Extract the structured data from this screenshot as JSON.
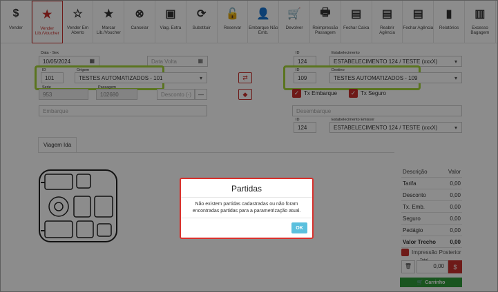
{
  "toolbar": [
    {
      "label": "Vender",
      "icon": "dollar-icon",
      "glyph": "$"
    },
    {
      "label": "Vender Lib./Voucher",
      "icon": "star-dollar-icon",
      "glyph": "★",
      "active": true
    },
    {
      "label": "Vender Em Aberto",
      "icon": "star-outline-icon",
      "glyph": "☆"
    },
    {
      "label": "Marcar Lib./Voucher",
      "icon": "star-filled-icon",
      "glyph": "★"
    },
    {
      "label": "Cancelar",
      "icon": "cancel-icon",
      "glyph": "⊗"
    },
    {
      "label": "Viag. Extra",
      "icon": "bus-icon",
      "glyph": "▣"
    },
    {
      "label": "Substituir",
      "icon": "refresh-icon",
      "glyph": "⟳"
    },
    {
      "label": "Reservar",
      "icon": "lock-icon",
      "glyph": "🔓"
    },
    {
      "label": "Embarque Não Emb.",
      "icon": "add-user-icon",
      "glyph": "👤"
    },
    {
      "label": "Devolver",
      "icon": "cart-return-icon",
      "glyph": "🛒"
    },
    {
      "label": "Reimpressão Passagem",
      "icon": "print-icon",
      "glyph": "🖶"
    },
    {
      "label": "Fechar Caixa",
      "icon": "register-icon",
      "glyph": "▤"
    },
    {
      "label": "Reabrir Agência",
      "icon": "register-icon",
      "glyph": "▤"
    },
    {
      "label": "Fechar Agência",
      "icon": "register-icon",
      "glyph": "▤"
    },
    {
      "label": "Relatórios",
      "icon": "document-icon",
      "glyph": "▮"
    },
    {
      "label": "Excesso Bagagem",
      "icon": "luggage-icon",
      "glyph": "▥"
    }
  ],
  "form": {
    "data_label": "Data - Sex",
    "data_value": "10/05/2024",
    "data_volta_placeholder": "Data Volta",
    "id_label": "ID",
    "origem_id": "101",
    "origem_label": "Origem",
    "origem_value": "TESTES AUTOMATIZADOS - 101",
    "serie_label": "Serie",
    "serie_value": "953",
    "passagem_label": "Passagem",
    "passagem_value": "102680",
    "desconto_placeholder": "Desconto (-)",
    "embarque_placeholder": "Embarque",
    "estab_id_label": "ID",
    "estab_id": "124",
    "estab_label": "Estabelecimento",
    "estab_value": "ESTABELECIMENTO 124 / TESTE (xxxX)",
    "destino_id": "109",
    "destino_label": "Destino",
    "destino_value": "TESTES AUTOMATIZADOS - 109",
    "tx_embarque": "Tx Embarque",
    "tx_seguro": "Tx Seguro",
    "desembarque_placeholder": "Desembarque",
    "emissor_label": "Estabelecimento Emissor",
    "emissor_id": "124",
    "emissor_value": "ESTABELECIMENTO 124 / TESTE (xxxX)"
  },
  "tabs": {
    "viagem_ida": "Viagem Ida"
  },
  "summary": {
    "col_desc": "Descrição",
    "col_valor": "Valor",
    "rows": [
      {
        "label": "Tarifa",
        "value": "0,00"
      },
      {
        "label": "Desconto",
        "value": "0,00"
      },
      {
        "label": "Tx. Emb.",
        "value": "0,00"
      },
      {
        "label": "Seguro",
        "value": "0,00"
      },
      {
        "label": "Pedágio",
        "value": "0,00"
      },
      {
        "label": "Valor Trecho",
        "value": "0,00"
      }
    ],
    "impressao_posterior": "Impressão Posterior",
    "total_label": "Total",
    "total_value": "0,00",
    "carrinho": "Carrinho"
  },
  "modal": {
    "title": "Partidas",
    "message": "Não existem partidas cadastradas ou não foram encontradas partidas para a parametrização atual.",
    "ok": "OK"
  },
  "colors": {
    "accent": "#c9302c",
    "highlight": "#a4d33a",
    "ok": "#5bc0de",
    "cart": "#2e9c3a"
  }
}
